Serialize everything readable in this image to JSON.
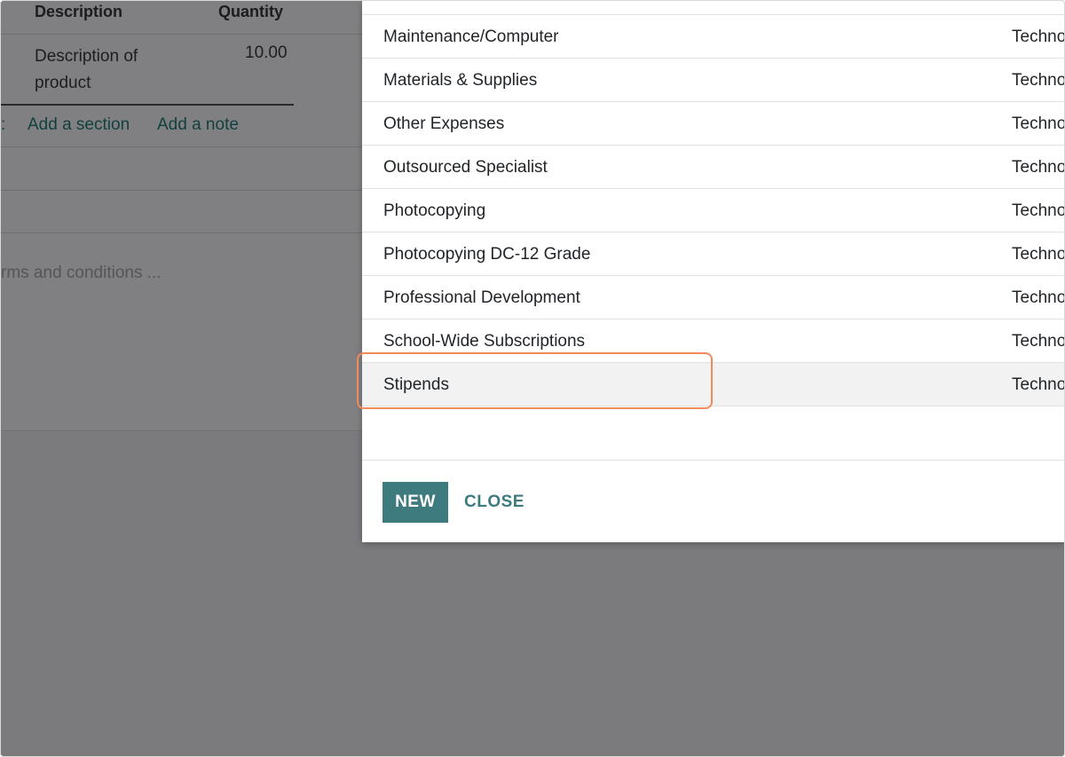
{
  "background_form": {
    "col_description": "Description",
    "col_quantity": "Quantity",
    "line_description": "Description of product",
    "line_quantity": "10.00",
    "add_section": "Add a section",
    "add_note": "Add a note",
    "terms_placeholder_visible": "rms and conditions ..."
  },
  "dialog": {
    "rows": [
      {
        "name": "Maintenance/Computer",
        "company": "Techno"
      },
      {
        "name": "Materials & Supplies",
        "company": "Techno"
      },
      {
        "name": "Other Expenses",
        "company": "Techno"
      },
      {
        "name": "Outsourced Specialist",
        "company": "Techno"
      },
      {
        "name": "Photocopying",
        "company": "Techno"
      },
      {
        "name": "Photocopying DC-12 Grade",
        "company": "Techno"
      },
      {
        "name": "Professional Development",
        "company": "Techno"
      },
      {
        "name": "School-Wide Subscriptions",
        "company": "Techno"
      },
      {
        "name": "Stipends",
        "company": "Techno"
      }
    ],
    "new_label": "NEW",
    "close_label": "CLOSE"
  },
  "colors": {
    "accent": "#3d7b7e",
    "highlight": "#f28a5a",
    "overlay": "#7b7b7e"
  }
}
